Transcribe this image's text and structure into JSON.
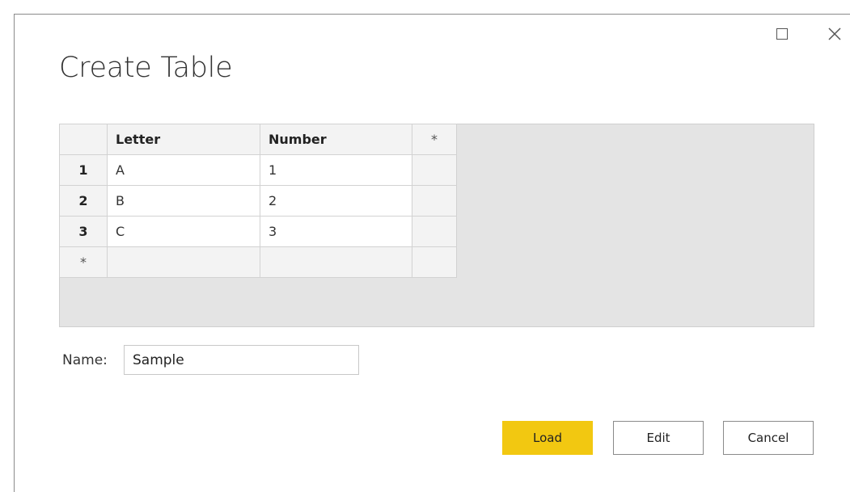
{
  "dialog": {
    "title": "Create Table",
    "maximize_icon": "maximize-icon",
    "close_icon": "close-icon",
    "close_glyph": "✕"
  },
  "table": {
    "add_column_marker": "*",
    "columns": [
      "Letter",
      "Number"
    ],
    "rows": [
      {
        "index": "1",
        "cells": [
          "A",
          "1"
        ]
      },
      {
        "index": "2",
        "cells": [
          "B",
          "2"
        ]
      },
      {
        "index": "3",
        "cells": [
          "C",
          "3"
        ]
      }
    ],
    "add_row_marker": "*"
  },
  "name_field": {
    "label": "Name:",
    "value": "Sample"
  },
  "buttons": {
    "load": "Load",
    "edit": "Edit",
    "cancel": "Cancel"
  },
  "colors": {
    "load_accent": "#f2c811"
  }
}
